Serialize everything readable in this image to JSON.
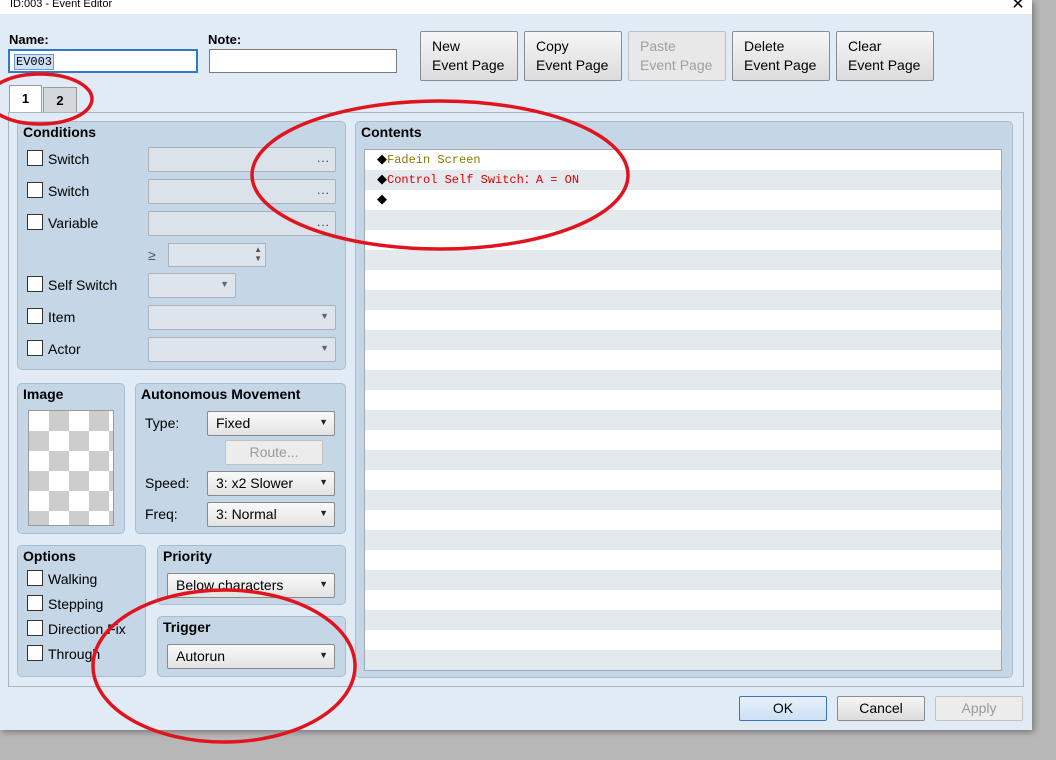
{
  "window": {
    "title": "ID:003 - Event Editor",
    "close_glyph": "✕"
  },
  "header": {
    "name_label": "Name:",
    "name_value": "EV003",
    "note_label": "Note:",
    "note_value": "",
    "buttons": [
      {
        "label": "New\nEvent Page",
        "enabled": true
      },
      {
        "label": "Copy\nEvent Page",
        "enabled": true
      },
      {
        "label": "Paste\nEvent Page",
        "enabled": false
      },
      {
        "label": "Delete\nEvent Page",
        "enabled": true
      },
      {
        "label": "Clear\nEvent Page",
        "enabled": true
      }
    ]
  },
  "tabs": [
    {
      "label": "1",
      "active": true
    },
    {
      "label": "2",
      "active": false
    }
  ],
  "conditions": {
    "title": "Conditions",
    "switch1_label": "Switch",
    "switch2_label": "Switch",
    "variable_label": "Variable",
    "ref_button_glyph": "...",
    "ge_symbol": "≥",
    "self_switch_label": "Self Switch",
    "item_label": "Item",
    "actor_label": "Actor"
  },
  "image": {
    "title": "Image"
  },
  "movement": {
    "title": "Autonomous Movement",
    "type_label": "Type:",
    "type_value": "Fixed",
    "route_label": "Route...",
    "speed_label": "Speed:",
    "speed_value": "3: x2 Slower",
    "freq_label": "Freq:",
    "freq_value": "3: Normal"
  },
  "options": {
    "title": "Options",
    "walking": "Walking",
    "stepping": "Stepping",
    "direction_fix": "Direction Fix",
    "through": "Through"
  },
  "priority": {
    "title": "Priority",
    "value": "Below characters"
  },
  "trigger": {
    "title": "Trigger",
    "value": "Autorun"
  },
  "contents": {
    "title": "Contents",
    "commands": [
      {
        "text": "Fadein Screen",
        "color": "#8a7a00"
      },
      {
        "text": "Control Self Switch：A = ON",
        "color": "#e00000"
      },
      {
        "text": "",
        "color": "#000000"
      }
    ]
  },
  "footer": {
    "ok": "OK",
    "cancel": "Cancel",
    "apply": "Apply"
  },
  "colors": {
    "annotation": "#e0141e",
    "panel": "#c5d6e6",
    "client": "#e1ebf5"
  }
}
